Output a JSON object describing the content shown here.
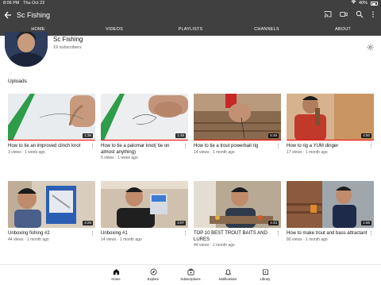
{
  "status_bar": {
    "time": "8:06 PM",
    "date": "Thu Oct 22",
    "battery": "40%"
  },
  "app_bar": {
    "title": "Sc Fishing"
  },
  "tabs": [
    "HOME",
    "VIDEOS",
    "PLAYLISTS",
    "CHANNELS",
    "ABOUT"
  ],
  "channel": {
    "name": "Sc Fishing",
    "subscribers": "19 subscribers"
  },
  "uploads": {
    "title": "Uploads",
    "videos": [
      {
        "title": "How to tie an improved clinch knot",
        "meta": "3 views · 1 week ago",
        "duration": "1:36"
      },
      {
        "title": "How to tie a palomar knot( tie on almost anything)",
        "meta": "5 views · 1 week ago",
        "duration": "1:48"
      },
      {
        "title": "How to tie a trout powerbait rig",
        "meta": "14 views · 1 month ago",
        "duration": "5:49"
      },
      {
        "title": "How to rig a YUM dinger",
        "meta": "17 views · 1 month ago",
        "duration": "4:50"
      },
      {
        "title": "Unboxing fishing #2",
        "meta": "44 views · 1 month ago",
        "duration": "4:26"
      },
      {
        "title": "Unboxing #1",
        "meta": "14 views · 1 month ago",
        "duration": "3:07"
      },
      {
        "title": "TOP 10 BEST TROUT BAITS AND LURES",
        "meta": "44 views · 1 month ago",
        "duration": "4:43"
      },
      {
        "title": "How to make trout and bass attractant",
        "meta": "80 views · 1 month ago",
        "duration": "1:56"
      }
    ]
  },
  "bottom_nav": [
    {
      "label": "Home",
      "icon": "home-icon"
    },
    {
      "label": "Explore",
      "icon": "explore-icon"
    },
    {
      "label": "Subscriptions",
      "icon": "subscriptions-icon"
    },
    {
      "label": "Notifications",
      "icon": "bell-icon"
    },
    {
      "label": "Library",
      "icon": "library-icon"
    }
  ],
  "colors": {
    "header_bg": "#404040",
    "progress": "#ff0000"
  }
}
